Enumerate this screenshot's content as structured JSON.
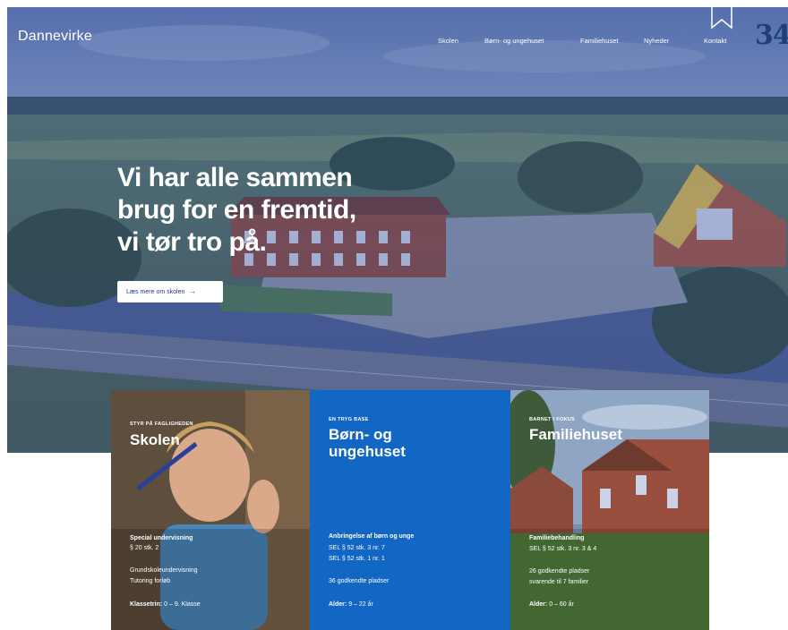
{
  "brand": {
    "logo": "Dannevirke"
  },
  "nav": {
    "items": [
      "Skolen",
      "Børn- og ungehuset",
      "Familiehuset",
      "Nyheder",
      "Kontakt"
    ]
  },
  "overlay": {
    "page_number": "34"
  },
  "hero": {
    "headline": [
      "Vi har alle sammen",
      "brug for en fremtid,",
      "vi tør tro på."
    ],
    "cta_label": "Læs mere om skolen",
    "cta_arrow": "→"
  },
  "cards": [
    {
      "eyebrow": "STYR PÅ FAGLIGHEDEN",
      "title": "Skolen",
      "lines": [
        "Special undervisning",
        "§ 20 stk. 2",
        "Grundskoleundervisning",
        "Tutoring forløb"
      ],
      "footer_label": "Klassetrin:",
      "footer_value": "0 – 9. Klasse"
    },
    {
      "eyebrow": "EN TRYG BASE",
      "title": "Børn- og ungehuset",
      "title_lines": [
        "Børn- og",
        "ungehuset"
      ],
      "lines": [
        "Anbringelse af børn og unge",
        "SEL § 52 stk. 3 nr. 7",
        "SEL § 52 stk. 1 nr. 1",
        "36 godkendte pladser"
      ],
      "footer_label": "Alder:",
      "footer_value": "9 – 22 år"
    },
    {
      "eyebrow": "BARNET I FOKUS",
      "title": "Familiehuset",
      "lines": [
        "Familiebehandling",
        "SEL § 52 stk. 3 nr. 3 & 4",
        "26 godkendte pladser",
        "svarende til 7 familier"
      ],
      "footer_label": "Alder:",
      "footer_value": "0 – 60 år"
    }
  ],
  "colors": {
    "hero_tint": "#3a55a0",
    "cta_text": "#1f3a8a",
    "card_blue": "#1266c4",
    "page_number": "#1c3f7a"
  },
  "icons": [
    "bookmark-icon",
    "arrow-right-icon"
  ]
}
